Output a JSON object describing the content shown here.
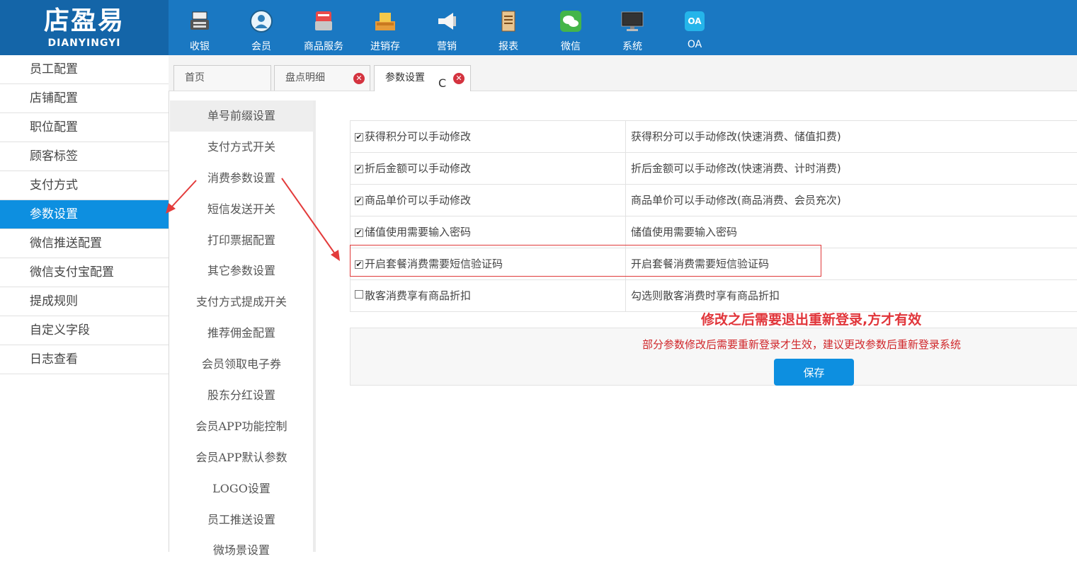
{
  "logo": {
    "cn": "店盈易",
    "en": "DIANYINGYI"
  },
  "nav": [
    {
      "label": "收银",
      "icon": "cashier-icon"
    },
    {
      "label": "会员",
      "icon": "member-icon"
    },
    {
      "label": "商品服务",
      "icon": "goods-icon"
    },
    {
      "label": "进销存",
      "icon": "inventory-icon"
    },
    {
      "label": "营销",
      "icon": "megaphone-icon"
    },
    {
      "label": "报表",
      "icon": "report-icon"
    },
    {
      "label": "微信",
      "icon": "wechat-icon"
    },
    {
      "label": "系统",
      "icon": "monitor-icon"
    },
    {
      "label": "OA",
      "icon": "oa-icon",
      "badge": "OA"
    }
  ],
  "sidebar": [
    {
      "label": "员工配置"
    },
    {
      "label": "店铺配置"
    },
    {
      "label": "职位配置"
    },
    {
      "label": "顾客标签"
    },
    {
      "label": "支付方式"
    },
    {
      "label": "参数设置",
      "active": true
    },
    {
      "label": "微信推送配置"
    },
    {
      "label": "微信支付宝配置"
    },
    {
      "label": "提成规则"
    },
    {
      "label": "自定义字段"
    },
    {
      "label": "日志查看"
    }
  ],
  "tabs": [
    {
      "label": "首页"
    },
    {
      "label": "盘点明细",
      "closable": true
    },
    {
      "label": "参数设置",
      "closable": true,
      "active": true,
      "refresh": true
    }
  ],
  "icons": {
    "close": "✕",
    "refresh": "C",
    "check": "✔"
  },
  "submenu": [
    {
      "label": "单号前缀设置",
      "active": true
    },
    {
      "label": "支付方式开关"
    },
    {
      "label": "消费参数设置"
    },
    {
      "label": "短信发送开关"
    },
    {
      "label": "打印票据配置"
    },
    {
      "label": "其它参数设置"
    },
    {
      "label": "支付方式提成开关"
    },
    {
      "label": "推荐佣金配置"
    },
    {
      "label": "会员领取电子券"
    },
    {
      "label": "股东分红设置"
    },
    {
      "label": "会员APP功能控制"
    },
    {
      "label": "会员APP默认参数"
    },
    {
      "label": "LOGO设置"
    },
    {
      "label": "员工推送设置"
    },
    {
      "label": "微场景设置"
    }
  ],
  "params": [
    {
      "label": "获得积分可以手动修改",
      "desc": "获得积分可以手动修改(快速消费、储值扣费)",
      "checked": true
    },
    {
      "label": "折后金额可以手动修改",
      "desc": "折后金额可以手动修改(快速消费、计时消费)",
      "checked": true
    },
    {
      "label": "商品单价可以手动修改",
      "desc": "商品单价可以手动修改(商品消费、会员充次)",
      "checked": true
    },
    {
      "label": "储值使用需要输入密码",
      "desc": "储值使用需要输入密码",
      "checked": true
    },
    {
      "label": "开启套餐消费需要短信验证码",
      "desc": "开启套餐消费需要短信验证码",
      "checked": true
    },
    {
      "label": "散客消费享有商品折扣",
      "desc": "勾选则散客消费时享有商品折扣",
      "checked": false
    }
  ],
  "warning": "修改之后需要退出重新登录,方才有效",
  "notice": "部分参数修改后需要重新登录才生效，建议更改参数后重新登录系统",
  "save_label": "保存",
  "colors": {
    "topbar": "#1a78c2",
    "accent": "#0d8fe0",
    "alert": "#e1353a"
  }
}
